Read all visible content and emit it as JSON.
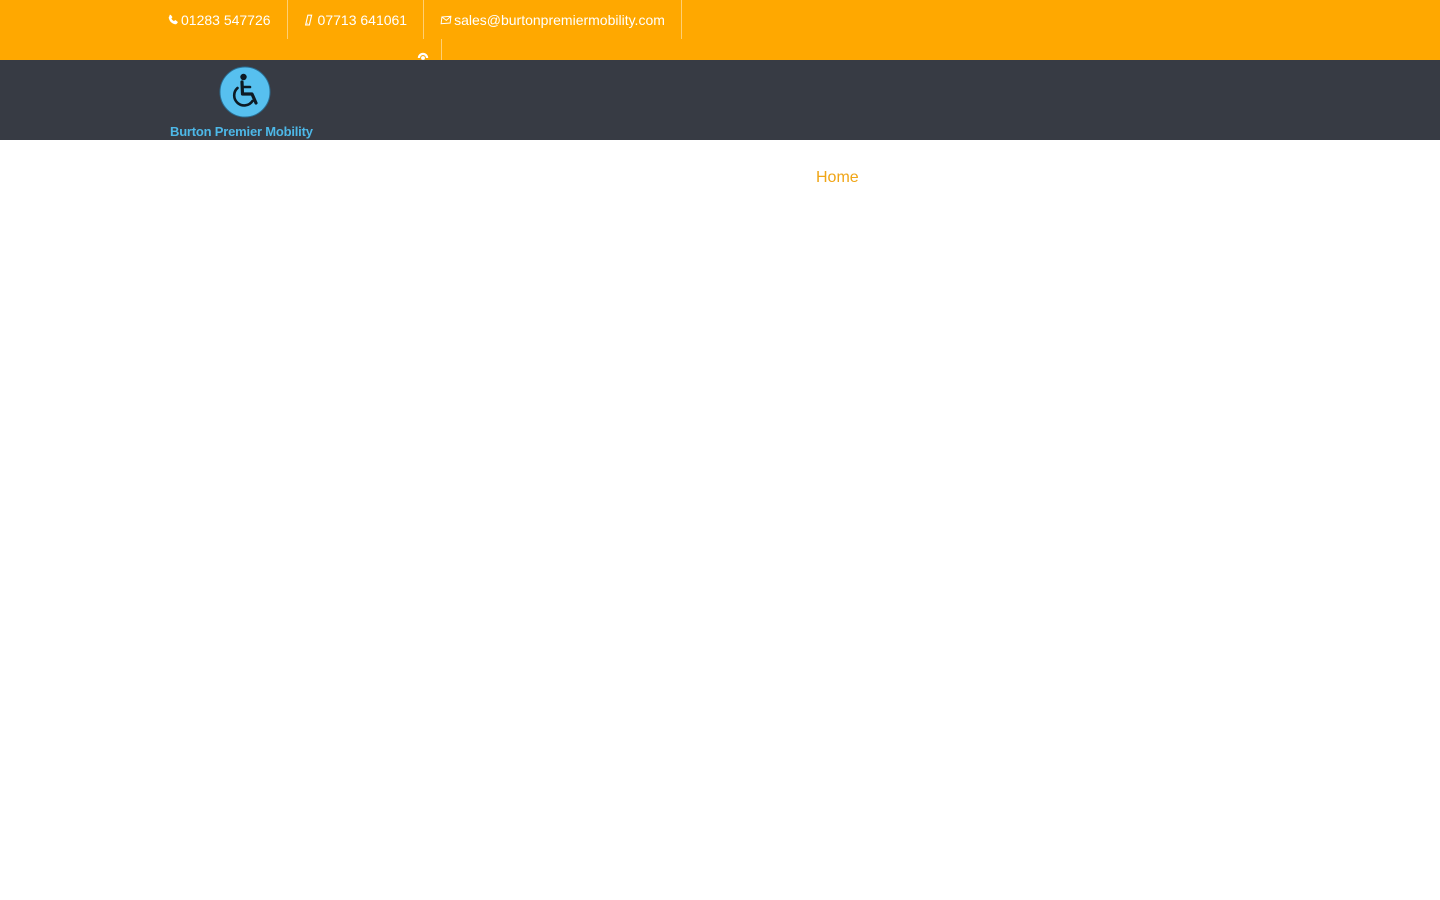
{
  "topbar": {
    "background": "#ffa800",
    "phone": {
      "icon": "phone-icon",
      "text": "01283 547726"
    },
    "mobile": {
      "icon": "mobile-phone-icon",
      "text": "07713 641061"
    },
    "email": {
      "icon": "envelope-icon",
      "text": "sales@burtonpremiermobility.com"
    },
    "social": {
      "icon": "social-link-icon"
    }
  },
  "header": {
    "background": "#373b44",
    "logo": {
      "icon": "wheelchair-icon",
      "text": "Burton Premier Mobility",
      "text_color": "#4db8e8",
      "badge_color": "#57c0ef"
    }
  },
  "main": {
    "breadcrumb": {
      "text": "Home",
      "color": "#f0a516"
    }
  }
}
